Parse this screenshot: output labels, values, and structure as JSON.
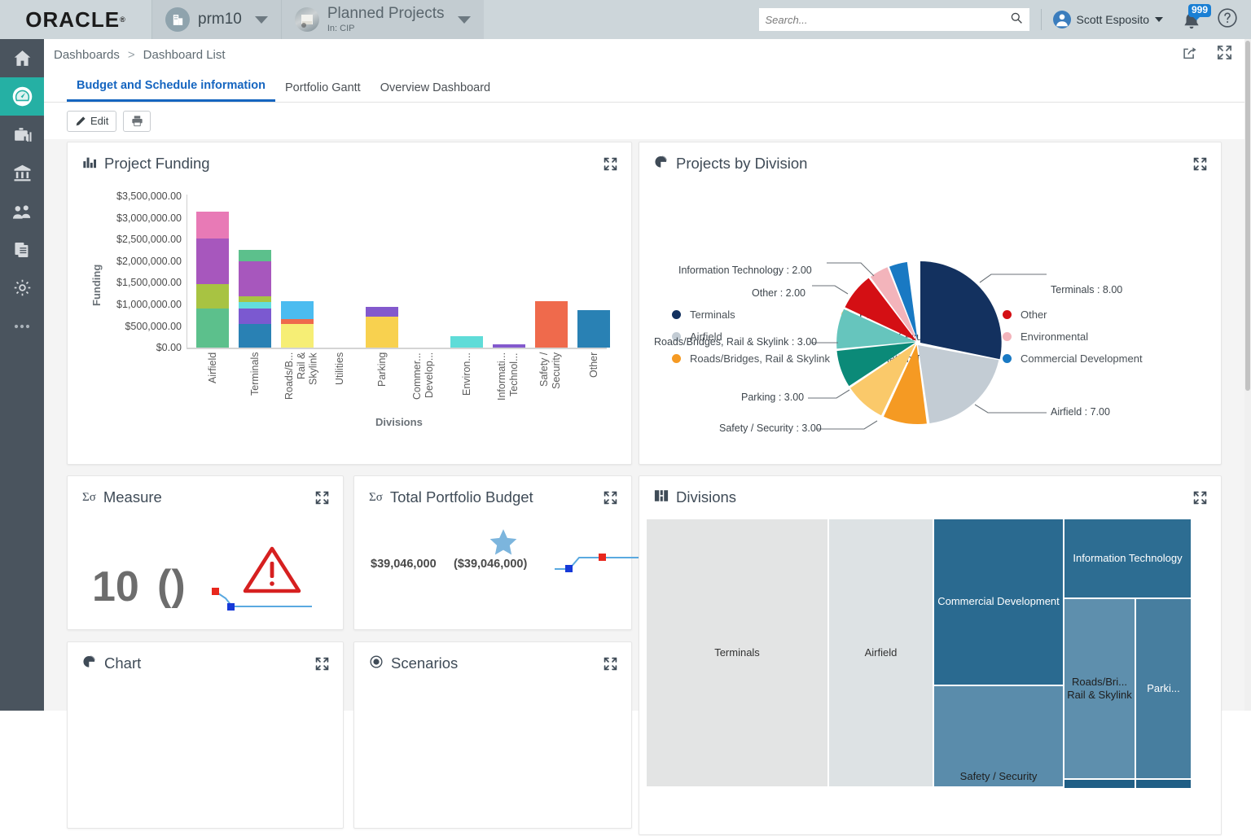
{
  "topbar": {
    "logo": "ORACLE",
    "app_chip": {
      "label": "prm10",
      "icon": "building-icon"
    },
    "project_chip": {
      "title": "Planned Projects",
      "subtitle": "In: CIP",
      "icon": "project-photo"
    },
    "search": {
      "placeholder": "Search...",
      "value": "",
      "icon": "search-icon"
    },
    "user": {
      "name": "Scott Esposito",
      "icon": "avatar-icon"
    },
    "notifications": {
      "count": "999",
      "icon": "bell-icon"
    },
    "help": {
      "icon": "help-icon"
    }
  },
  "sidebar": {
    "items": [
      {
        "name": "home",
        "icon": "home-icon",
        "active": false
      },
      {
        "name": "dashboards",
        "icon": "gauge-icon",
        "active": true
      },
      {
        "name": "portfolio",
        "icon": "briefcase-chart-icon",
        "active": false
      },
      {
        "name": "organization",
        "icon": "bank-icon",
        "active": false
      },
      {
        "name": "resources",
        "icon": "people-icon",
        "active": false
      },
      {
        "name": "reports",
        "icon": "documents-icon",
        "active": false
      },
      {
        "name": "settings",
        "icon": "gear-icon",
        "active": false
      },
      {
        "name": "more",
        "icon": "ellipsis-icon",
        "active": false
      }
    ]
  },
  "breadcrumb": {
    "root": "Dashboards",
    "separator": ">",
    "current": "Dashboard List"
  },
  "page_actions": {
    "share": "share-icon",
    "fullscreen": "fullscreen-icon"
  },
  "tabs": [
    {
      "label": "Budget and Schedule information",
      "active": true
    },
    {
      "label": "Portfolio Gantt",
      "active": false
    },
    {
      "label": "Overview Dashboard",
      "active": false
    }
  ],
  "toolbar": {
    "edit_label": "Edit",
    "edit_icon": "pencil-icon",
    "print_icon": "printer-icon"
  },
  "panels": {
    "project_funding": {
      "title": "Project Funding",
      "icon": "bar-chart-icon",
      "expand": "expand-icon"
    },
    "projects_by_division": {
      "title": "Projects by Division",
      "icon": "pie-chart-icon",
      "expand": "expand-icon"
    },
    "measure": {
      "title": "Measure",
      "icon": "sigma-icon",
      "expand": "expand-icon"
    },
    "total_portfolio_budget": {
      "title": "Total Portfolio Budget",
      "icon": "sigma-icon",
      "expand": "expand-icon"
    },
    "divisions": {
      "title": "Divisions",
      "icon": "treemap-icon",
      "expand": "expand-icon"
    },
    "chart": {
      "title": "Chart",
      "icon": "pie-chart-icon",
      "expand": "expand-icon"
    },
    "scenarios": {
      "title": "Scenarios",
      "icon": "target-icon",
      "expand": "expand-icon"
    }
  },
  "measure": {
    "value": "10",
    "paren": "()",
    "warning_icon": "warning-triangle-icon",
    "spark_icon": "sparkline-icon"
  },
  "total_portfolio_budget": {
    "value_a": "$39,046,000",
    "value_b": "($39,046,000)",
    "star_icon": "star-icon",
    "spark_icon": "sparkline-icon"
  },
  "chart_data": [
    {
      "type": "bar",
      "title": "Project Funding",
      "stacked": true,
      "xlabel": "Divisions",
      "ylabel": "Funding",
      "ylim": [
        0,
        3500000
      ],
      "yticks": [
        "$0.00",
        "$500,000.00",
        "$1,000,000.00",
        "$1,500,000.00",
        "$2,000,000.00",
        "$2,500,000.00",
        "$3,000,000.00",
        "$3,500,000.00"
      ],
      "categories": [
        "Airfield",
        "Terminals",
        "Roads/B... Rail & Skylink",
        "Utilities",
        "Parking",
        "Commer... Develop...",
        "Environ...",
        "Informati... Technol...",
        "Safety / Security",
        "Other"
      ],
      "bars": [
        {
          "category": "Airfield",
          "total": 3130000,
          "segments": [
            {
              "color": "#5cc08c",
              "value": 900000
            },
            {
              "color": "#a8c342",
              "value": 560000
            },
            {
              "color": "#a757bd",
              "value": 1050000
            },
            {
              "color": "#e87ab6",
              "value": 620000
            }
          ]
        },
        {
          "category": "Terminals",
          "total": 2230000,
          "segments": [
            {
              "color": "#2981b4",
              "value": 540000
            },
            {
              "color": "#7b59d0",
              "value": 360000
            },
            {
              "color": "#62dede",
              "value": 140000
            },
            {
              "color": "#a8c342",
              "value": 130000
            },
            {
              "color": "#a757bd",
              "value": 800000
            },
            {
              "color": "#5cc08c",
              "value": 260000
            }
          ]
        },
        {
          "category": "Roads/B... Rail & Skylink",
          "total": 1060000,
          "segments": [
            {
              "color": "#f6ee75",
              "value": 540000
            },
            {
              "color": "#ef6a4c",
              "value": 110000
            },
            {
              "color": "#4bbcf0",
              "value": 410000
            }
          ]
        },
        {
          "category": "Utilities",
          "total": 0,
          "segments": []
        },
        {
          "category": "Parking",
          "total": 940000,
          "segments": [
            {
              "color": "#f8d14f",
              "value": 720000
            },
            {
              "color": "#8359cd",
              "value": 220000
            }
          ]
        },
        {
          "category": "Commer... Develop...",
          "total": 0,
          "segments": []
        },
        {
          "category": "Environ...",
          "total": 270000,
          "segments": [
            {
              "color": "#5fdcd8",
              "value": 270000
            }
          ]
        },
        {
          "category": "Informati... Technol...",
          "total": 70000,
          "segments": [
            {
              "color": "#8359cd",
              "value": 70000
            }
          ]
        },
        {
          "category": "Safety / Security",
          "total": 1080000,
          "segments": [
            {
              "color": "#ef6a4c",
              "value": 1080000
            }
          ]
        },
        {
          "category": "Other",
          "total": 870000,
          "segments": [
            {
              "color": "#2981b4",
              "value": 870000
            }
          ]
        }
      ]
    },
    {
      "type": "pie",
      "title": "Projects by Division",
      "legend_position": "top",
      "labels": [
        "Terminals",
        "Airfield",
        "Roads/Bridges, Rail & Skylink",
        "Parking",
        "Safety / Security",
        "Information Technology",
        "Other",
        "Environmental",
        "Commercial Development"
      ],
      "values": [
        8,
        7,
        3,
        3,
        3,
        2,
        2,
        1,
        1
      ],
      "colors": [
        "#13315f",
        "#c3ccd4",
        "#f59a23",
        "#fac96a",
        "#0b8a78",
        "#66c5bd",
        "#d40f14",
        "#f3b4bb",
        "#1979c3"
      ],
      "annotations": [
        "Terminals : 8.00",
        "Airfield : 7.00",
        "Safety / Security : 3.00",
        "Parking : 3.00",
        "Roads/Bridges, Rail & Skylink : 3.00",
        "Other : 2.00",
        "Information Technology : 2.00"
      ],
      "legend": [
        {
          "label": "Terminals",
          "color": "#13315f"
        },
        {
          "label": "Airfield",
          "color": "#c3ccd4"
        },
        {
          "label": "Roads/Bridges, Rail & Skylink",
          "color": "#f59a23"
        },
        {
          "label": "Parking",
          "color": "#fac96a"
        },
        {
          "label": "Safety / Security",
          "color": "#0b8a78"
        },
        {
          "label": "Information Technology",
          "color": "#66c5bd"
        },
        {
          "label": "Other",
          "color": "#d40f14"
        },
        {
          "label": "Environmental",
          "color": "#f3b4bb"
        },
        {
          "label": "Commercial Development",
          "color": "#1979c3"
        }
      ]
    },
    {
      "type": "treemap",
      "title": "Divisions",
      "cells": [
        {
          "label": "Terminals",
          "color": "#e3e4e4",
          "text_color": "#333333"
        },
        {
          "label": "Airfield",
          "color": "#dde2e4",
          "text_color": "#333333"
        },
        {
          "label": "Commercial Development",
          "color": "#2a6a90",
          "text_color": "#ffffff"
        },
        {
          "label": "Information Technology",
          "color": "#2d6d92",
          "text_color": "#ffffff"
        },
        {
          "label": "Safety / Security",
          "color": "#5a8cab",
          "text_color": "#222222"
        },
        {
          "label": "Roads/Bri... Rail & Skylink",
          "color": "#5e8fad",
          "text_color": "#222222"
        },
        {
          "label": "Parki...",
          "color": "#477e9f",
          "text_color": "#ffffff"
        },
        {
          "label": "",
          "color": "#1f5e85",
          "text_color": "#ffffff"
        },
        {
          "label": "",
          "color": "#1f5e85",
          "text_color": "#ffffff"
        }
      ]
    }
  ]
}
